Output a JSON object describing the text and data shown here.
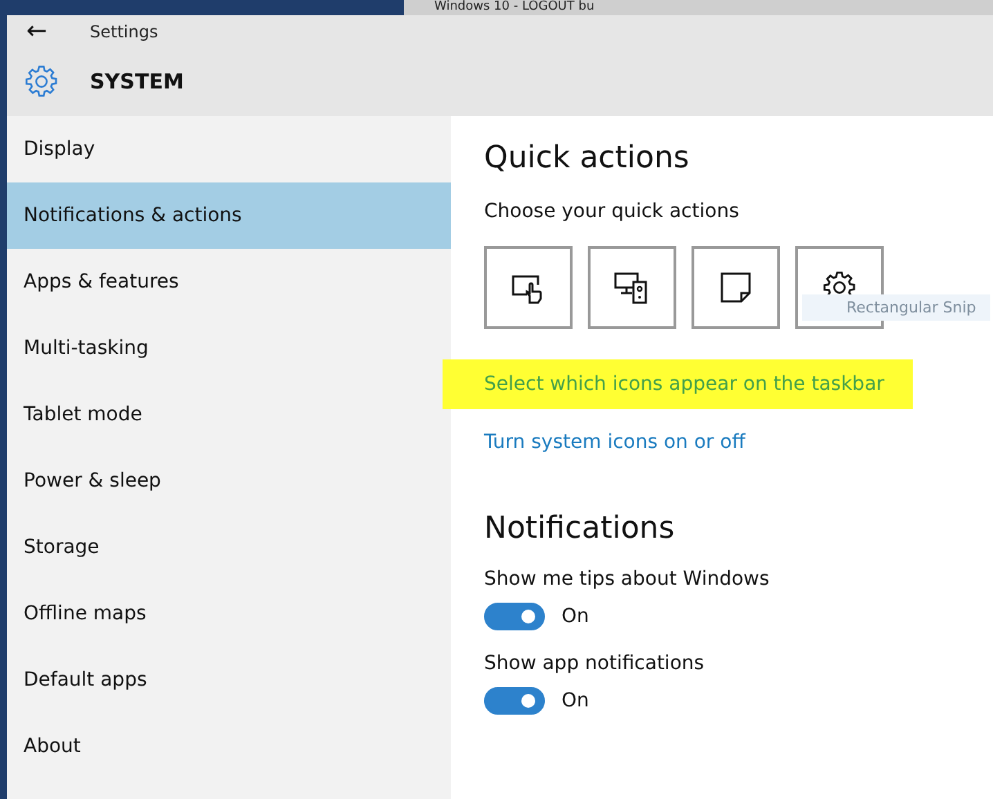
{
  "browser_tab": {
    "title": "Windows 10 - LOGOUT bu"
  },
  "window": {
    "title": "Settings",
    "back": "←"
  },
  "header": {
    "title": "SYSTEM"
  },
  "sidebar": {
    "items": [
      {
        "label": "Display",
        "selected": false
      },
      {
        "label": "Notifications & actions",
        "selected": true
      },
      {
        "label": "Apps & features",
        "selected": false
      },
      {
        "label": "Multi-tasking",
        "selected": false
      },
      {
        "label": "Tablet mode",
        "selected": false
      },
      {
        "label": "Power & sleep",
        "selected": false
      },
      {
        "label": "Storage",
        "selected": false
      },
      {
        "label": "Offline maps",
        "selected": false
      },
      {
        "label": "Default apps",
        "selected": false
      },
      {
        "label": "About",
        "selected": false
      }
    ]
  },
  "quick_actions": {
    "title": "Quick actions",
    "subtitle": "Choose your quick actions",
    "tiles": [
      {
        "kind": "tablet"
      },
      {
        "kind": "connect"
      },
      {
        "kind": "note"
      },
      {
        "kind": "settings"
      }
    ],
    "tooltip": "Rectangular Snip",
    "links": [
      {
        "label": "Select which icons appear on the taskbar",
        "highlighted": true
      },
      {
        "label": "Turn system icons on or off",
        "highlighted": false
      }
    ]
  },
  "notifications": {
    "title": "Notifications",
    "settings": [
      {
        "label": "Show me tips about Windows",
        "on": true,
        "state": "On"
      },
      {
        "label": "Show app notifications",
        "on": true,
        "state": "On"
      }
    ]
  }
}
